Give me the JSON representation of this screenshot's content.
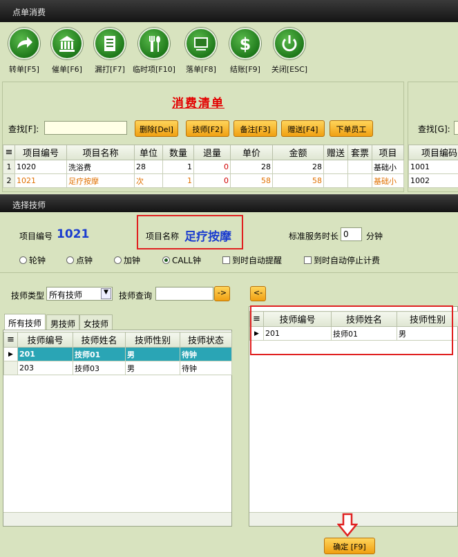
{
  "window": {
    "title": "点单消费"
  },
  "toolbar": [
    {
      "label": "转单[F5]",
      "icon": "transfer-arrow-icon"
    },
    {
      "label": "催单[F6]",
      "icon": "bank-icon"
    },
    {
      "label": "漏打[F7]",
      "icon": "document-icon"
    },
    {
      "label": "临时项[F10]",
      "icon": "cutlery-icon"
    },
    {
      "label": "落单[F8]",
      "icon": "monitor-icon"
    },
    {
      "label": "结账[F9]",
      "icon": "dollar-icon"
    },
    {
      "label": "关闭[ESC]",
      "icon": "power-icon"
    }
  ],
  "consume": {
    "title": "消费清单",
    "search_label": "查找[F]:",
    "search_value": "",
    "buttons": [
      "删除[Del]",
      "技师[F2]",
      "备注[F3]",
      "赠送[F4]",
      "下单员工"
    ],
    "columns": [
      "项目编号",
      "项目名称",
      "单位",
      "数量",
      "退量",
      "单价",
      "金额",
      "赠送",
      "套票",
      "项目"
    ],
    "rows": [
      {
        "no": "1",
        "code": "1020",
        "name": "洗浴费",
        "unit": "28",
        "qty": "1",
        "ret": "0",
        "price": "28",
        "amount": "28",
        "gift": "",
        "pkg": "",
        "cat": "基础小"
      },
      {
        "no": "2",
        "code": "1021",
        "name": "足疗按摩",
        "unit": "次",
        "qty": "1",
        "ret": "0",
        "price": "58",
        "amount": "58",
        "gift": "",
        "pkg": "",
        "cat": "基础小"
      }
    ]
  },
  "right_panel": {
    "search_label": "查找[G]:",
    "column": "项目编码",
    "rows": [
      "1001",
      "1002"
    ]
  },
  "dialog": {
    "title": "选择技师",
    "item_code_label": "项目编号",
    "item_code": "1021",
    "item_name_label": "项目名称",
    "item_name": "足疗按摩",
    "duration_label": "标准服务时长",
    "duration_value": "0",
    "duration_unit": "分钟",
    "radios": [
      {
        "label": "轮钟",
        "checked": false
      },
      {
        "label": "点钟",
        "checked": false
      },
      {
        "label": "加钟",
        "checked": false
      },
      {
        "label": "CALL钟",
        "checked": true
      }
    ],
    "checks": [
      {
        "label": "到时自动提醒",
        "checked": false
      },
      {
        "label": "到时自动停止计费",
        "checked": false
      }
    ],
    "type_label": "技师类型",
    "type_value": "所有技师",
    "query_label": "技师查询",
    "query_value": "",
    "go_button": "->",
    "back_button": "<-",
    "tabs": [
      "所有技师",
      "男技师",
      "女技师"
    ],
    "left_columns": [
      "技师编号",
      "技师姓名",
      "技师性别",
      "技师状态"
    ],
    "left_rows": [
      {
        "code": "201",
        "name": "技师01",
        "gender": "男",
        "status": "待钟"
      },
      {
        "code": "203",
        "name": "技师03",
        "gender": "男",
        "status": "待钟"
      }
    ],
    "right_columns": [
      "技师编号",
      "技师姓名",
      "技师性别"
    ],
    "right_rows": [
      {
        "code": "201",
        "name": "技师01",
        "gender": "男"
      }
    ],
    "confirm_button": "确定 [F9]"
  }
}
